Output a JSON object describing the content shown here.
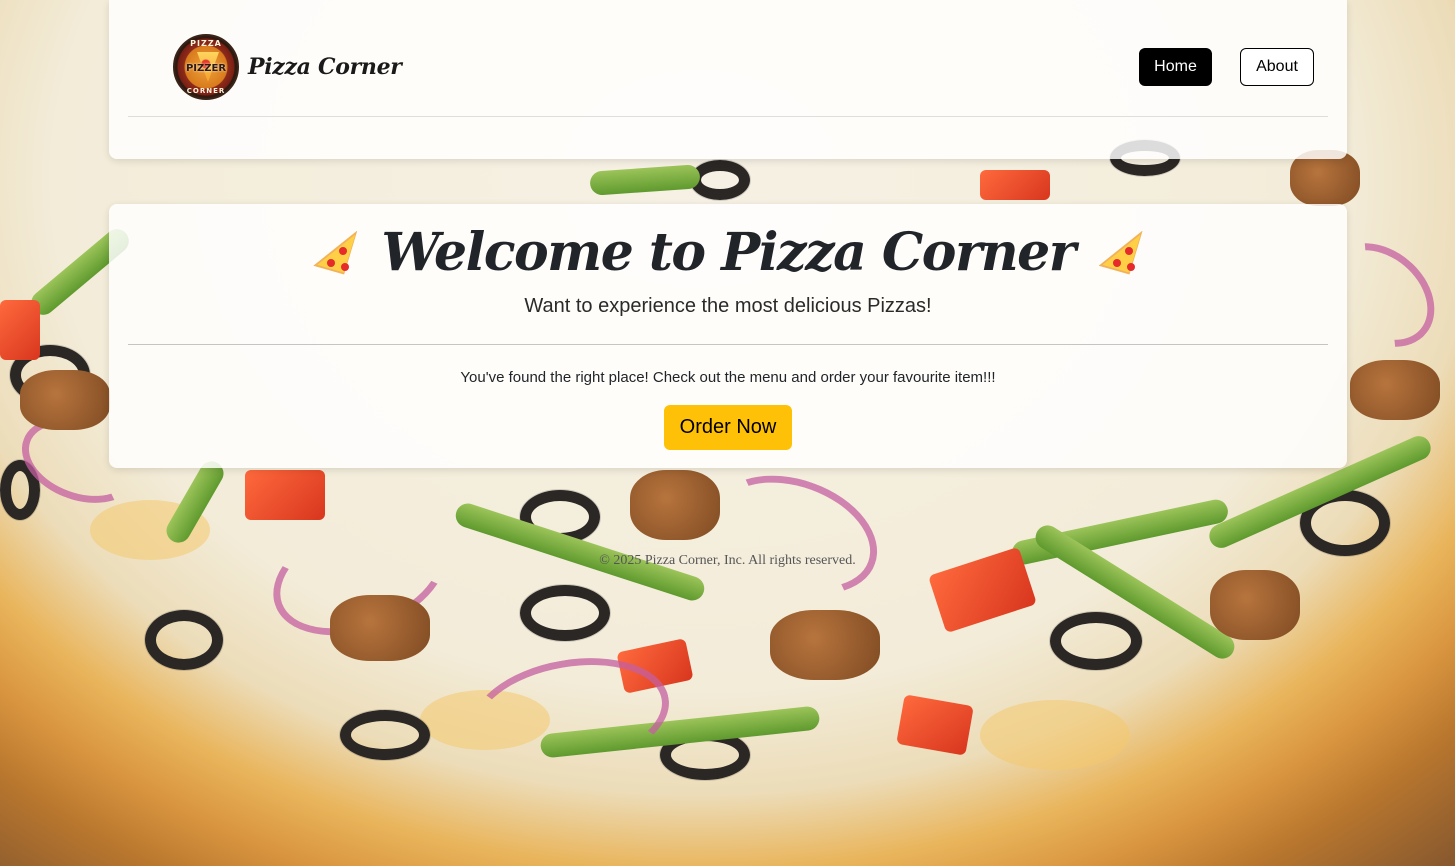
{
  "navbar": {
    "brand_name": "Pizza Corner",
    "logo_text_top": "PIZZA",
    "logo_text_mid": "PIZZER",
    "logo_text_bottom": "CORNER",
    "home_label": "Home",
    "about_label": "About"
  },
  "hero": {
    "title": "Welcome to Pizza Corner",
    "subtitle": "Want to experience the most delicious Pizzas!",
    "text": "You've found the right place! Check out the menu and order your favourite item!!!",
    "order_button_label": "Order Now",
    "title_icon": "pizza-slice-icon"
  },
  "footer": {
    "copyright": "© 2025 Pizza Corner, Inc. All rights reserved."
  },
  "colors": {
    "home_button_bg": "#000000",
    "order_button_bg": "#ffc107",
    "card_bg": "rgba(255,255,255,0.84)"
  }
}
